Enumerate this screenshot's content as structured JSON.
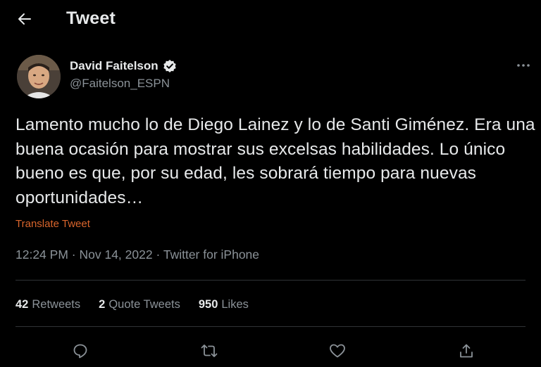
{
  "header": {
    "back_icon": "arrow-left-icon",
    "title": "Tweet"
  },
  "author": {
    "name": "David Faitelson",
    "handle": "@Faitelson_ESPN",
    "verified": true,
    "avatar_icon": "avatar"
  },
  "tweet": {
    "text": "Lamento mucho lo de Diego Lainez y lo de Santi Giménez. Era una buena ocasión para mostrar sus excelsas habilidades. Lo único bueno es que, por su edad, les sobrará tiempo para nuevas oportunidades…",
    "translate_label": "Translate Tweet",
    "time": "12:24 PM",
    "separator": "·",
    "date": "Nov 14, 2022",
    "source": "Twitter for iPhone"
  },
  "stats": {
    "retweets_count": "42",
    "retweets_label": "Retweets",
    "quotes_count": "2",
    "quotes_label": "Quote Tweets",
    "likes_count": "950",
    "likes_label": "Likes"
  },
  "actions": [
    "reply-icon",
    "retweet-icon",
    "like-icon",
    "share-icon"
  ],
  "colors": {
    "background": "#000000",
    "text": "#e7e9ea",
    "secondary": "#8b9298",
    "translate": "#d9652c",
    "verified": "#e7e9ea",
    "divider": "#2f3336"
  }
}
